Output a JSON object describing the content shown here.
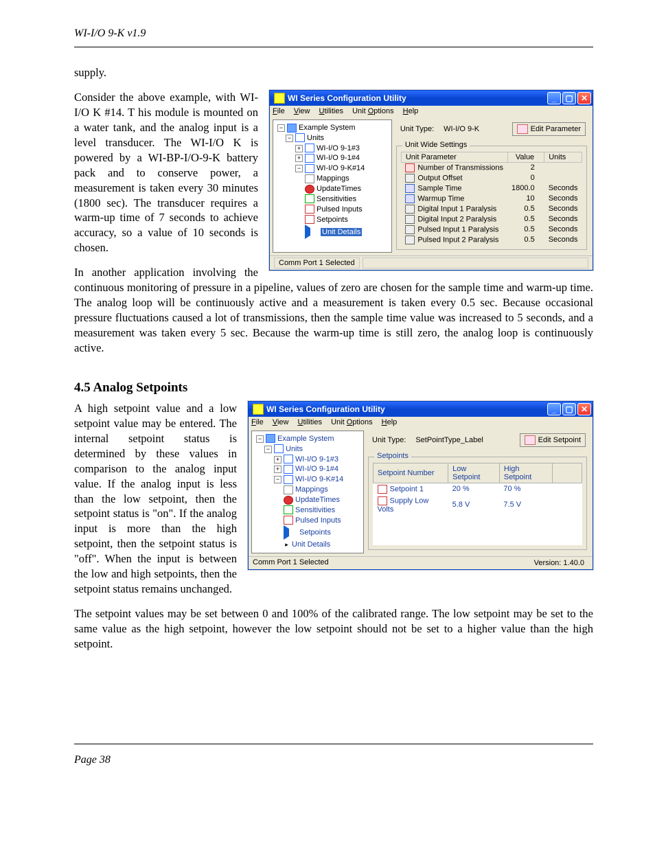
{
  "running_header": "WI-I/O 9-K v1.9",
  "footer": "Page 38",
  "paragraphs": {
    "p0": "supply.",
    "p1": "Consider the above example, with WI-I/O K #14.  T his module is mounted on a water tank,  and the analog input is a level transducer.  The WI-I/O K is powered by a WI-BP-I/O-9-K battery pack and to conserve power,  a measurement is taken every 30 minutes (1800 sec).  The transducer requires a warm-up time of 7 seconds to achieve accuracy,  so a value of 10 seconds is chosen.",
    "p2": "In another application involving the continuous monitoring of pressure in a pipeline,  values of zero are chosen for the sample time and warm-up time.  The analog loop will be continuously active and a measurement is taken every 0.5 sec.  Because occasional pressure fluctuations caused a lot of transmissions,  then the sample time value was increased to 5 seconds,  and a measurement was taken every 5 sec.  Because the warm-up time is still zero,  the analog loop is continuously active.",
    "p3": "A high setpoint value and a low setpoint value may be entered.  The internal setpoint status is determined by these values in comparison to the analog input value.  If the analog input is less than the low setpoint, then the setpoint status is \"on\".  If the analog input is more than the high setpoint, then the setpoint status is \"off\".  When the input is between the low and high setpoints, then the setpoint status remains unchanged.",
    "p4": "The setpoint values may be set between 0 and 100% of the calibrated range.  The low setpoint may be set to the same value as the high setpoint, however the low setpoint should not be set to a higher value than the high setpoint."
  },
  "section_4_5": "4.5   Analog Setpoints",
  "win1": {
    "title": "WI Series Configuration Utility",
    "menus": {
      "file": "File",
      "view": "View",
      "utilities": "Utilities",
      "unitopts": "Unit Options",
      "help": "Help"
    },
    "tree": {
      "root": "Example System",
      "units": "Units",
      "n1": "WI-I/O 9-1#3",
      "n2": "WI-I/O 9-1#4",
      "n3": "WI-I/O 9-K#14",
      "mappings": "Mappings",
      "update": "UpdateTimes",
      "sens": "Sensitivities",
      "pulsed": "Pulsed Inputs",
      "setp": "Setpoints",
      "details": "Unit Details"
    },
    "right": {
      "unit_type_lab": "Unit Type:",
      "unit_type_val": "WI-I/O 9-K",
      "edit_btn": "Edit Parameter",
      "group": "Unit Wide Settings",
      "th_param": "Unit Parameter",
      "th_value": "Value",
      "th_units": "Units",
      "rows": [
        {
          "name": "Number of Transmissions",
          "value": "2",
          "units": ""
        },
        {
          "name": "Output Offset",
          "value": "0",
          "units": ""
        },
        {
          "name": "Sample Time",
          "value": "1800.0",
          "units": "Seconds"
        },
        {
          "name": "Warmup Time",
          "value": "10",
          "units": "Seconds"
        },
        {
          "name": "Digital Input 1 Paralysis",
          "value": "0.5",
          "units": "Seconds"
        },
        {
          "name": "Digital Input 2 Paralysis",
          "value": "0.5",
          "units": "Seconds"
        },
        {
          "name": "Pulsed Input 1 Paralysis",
          "value": "0.5",
          "units": "Seconds"
        },
        {
          "name": "Pulsed Input 2 Paralysis",
          "value": "0.5",
          "units": "Seconds"
        }
      ]
    },
    "status": "Comm Port 1 Selected"
  },
  "win2": {
    "title": "WI Series Configuration Utility",
    "menus": {
      "file": "File",
      "view": "View",
      "utilities": "Utilities",
      "unitopts": "Unit Options",
      "help": "Help"
    },
    "tree": {
      "root": "Example System",
      "units": "Units",
      "n1": "WI-I/O 9-1#3",
      "n2": "WI-I/O 9-1#4",
      "n3": "WI-I/O 9-K#14",
      "mappings": "Mappings",
      "update": "UpdateTimes",
      "sens": "Sensitivities",
      "pulsed": "Pulsed Inputs",
      "setp": "Setpoints",
      "details": "Unit Details"
    },
    "right": {
      "unit_type_lab": "Unit Type:",
      "unit_type_val": "SetPointType_Label",
      "edit_btn": "Edit Setpoint",
      "group": "Setpoints",
      "th_num": "Setpoint Number",
      "th_low": "Low Setpoint",
      "th_high": "High Setpoint",
      "rows": [
        {
          "name": "Setpoint 1",
          "low": "20 %",
          "high": "70 %"
        },
        {
          "name": "Supply Low Volts",
          "low": "5.8 V",
          "high": "7.5 V"
        }
      ]
    },
    "status": "Comm Port 1 Selected",
    "version": "Version: 1.40.0"
  }
}
